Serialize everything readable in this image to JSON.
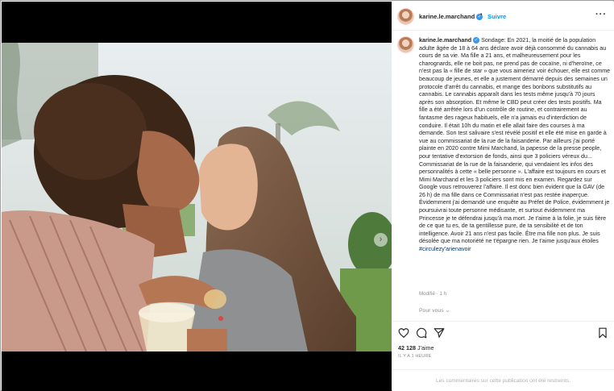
{
  "post": {
    "username": "karine.le.marchand",
    "dot": "•",
    "follow_label": "Suivre",
    "more_label": "···",
    "next_arrow": "›"
  },
  "caption": {
    "username": "karine.le.marchand",
    "text": "Sondage: En 2021, la moitié de la population adulte âgée de 18 à 64 ans déclare avoir déjà consommé du cannabis au cours de sa vie. Ma fille a 21 ans, et malheureusement pour les charognards, elle ne boit pas, ne prend pas de cocaïne, ni d'heroïne, ce n'est pas la « fille de star » que vous aimeriez voir échouer, elle est comme beaucoup de jeunes, et elle a justement démarré depuis des semaines un protocole d'arrêt du cannabis, et mange des bonbons substitutifs au cannabis. Le cannabis apparaît dans les tests même jusqu'à 70 jours après son absorption. Et même le CBD peut créer des tests positifs. Ma fille a été arrêtée lors d'un contrôle de routine, et contrairement au fantasme des rageux habituels, elle n'a jamais eu d'interdiction de conduire. Il était 10h du matin et elle allait faire des courses à ma demande. Son test salivaire s'est révélé positif et elle été mise en garde à vue au commissariat de la rue de la faisanderie. Par ailleurs j'ai porté plainte en 2020 contre Mimi Marchand, la papesse de la presse people, pour tentative d'extorsion de fonds, ainsi que 3 policiers véreux du... Commissariat de la rue de la faisanderie, qui vendaient les infos des personnalités à cette « belle personne ». L'affaire est toujours en cours et Mimi Marchand et les 3 policiers sont mis en examen. Regardez sur Google vous retrouverez l'affaire. Il est donc bien évident que la GAV (de 26 h) de ma fille dans ce Commissariat n'est pas restée inaperçue. Évidemment j'ai demandé une enquête au Préfet de Police, évidemment je poursuivrai toute personne médisante, et surtout évidemment ma Princesse je te défendrai jusqu'à ma mort. Je t'aime à la folie, je suis fière de ce que tu es, de ta gentillesse pure, de ta sensibilité et de ton intelligence. Avoir 21 ans n'est pas facile. Être ma fille non plus. Je suis désolée que ma notoriété ne t'épargne rien. Je t'aime jusqu'aux étoiles ",
    "hashtag": "#circulezy'arienavoir",
    "time": "Modifié · 1 h",
    "translate": "Pour vous ⌄"
  },
  "actions": {
    "likes_count": "42 128",
    "likes_label": "J'aime",
    "ago": "IL Y A 1 HEURE"
  },
  "footer": {
    "comments_off": "Les commentaires sur cette publication ont été restreints."
  },
  "icons": [
    "verified-badge-icon",
    "heart-icon",
    "comment-icon",
    "share-icon",
    "bookmark-icon",
    "chevron-right-icon",
    "more-options-icon"
  ],
  "colors": {
    "link_blue": "#0095f6",
    "verified_blue": "#3897f0",
    "muted": "#8e8e8e"
  }
}
